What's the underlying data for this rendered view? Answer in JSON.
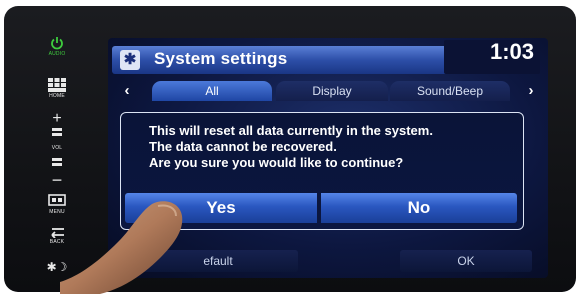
{
  "hard_keys": {
    "audio_label": "AUDIO",
    "home_label": "HOME",
    "vol_plus": "+",
    "vol_label": "VOL",
    "vol_minus": "−",
    "menu_label": "MENU",
    "back_label": "BACK",
    "night_label": "✱☽"
  },
  "header": {
    "title": "System settings",
    "clock": "1:03"
  },
  "tabs": {
    "prev_label": "‹",
    "next_label": "›",
    "items": [
      {
        "label": "All",
        "active": true
      },
      {
        "label": "Display",
        "active": false
      },
      {
        "label": "Sound/Beep",
        "active": false
      }
    ]
  },
  "dialog": {
    "lines": [
      "This will reset all data currently in the system.",
      "The data cannot be recovered.",
      "Are you sure you would like to continue?"
    ],
    "yes_label": "Yes",
    "no_label": "No"
  },
  "footer": {
    "default_label": "efault",
    "ok_label": "OK"
  },
  "colors": {
    "accent_blue": "#2a57c0",
    "screen_bg": "#0d1740",
    "power_green": "#3ecb3e"
  },
  "icons": [
    "power-icon",
    "home-grid-icon",
    "menu-icon",
    "back-icon",
    "night-mode-icon",
    "settings-gear-icon"
  ]
}
